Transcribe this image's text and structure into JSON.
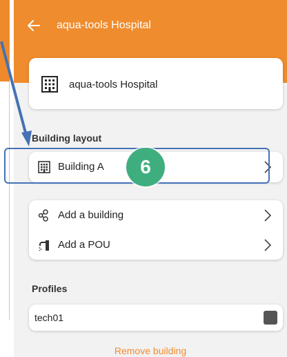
{
  "app": {
    "title": "aqua-tools Hospital",
    "accent": "#ef8c2e"
  },
  "hospital_card": {
    "name": "aqua-tools Hospital",
    "icon": "building-grid-icon"
  },
  "building_layout": {
    "heading": "Building layout",
    "items": [
      {
        "label": "Building A",
        "icon": "building-grid-icon"
      }
    ]
  },
  "actions": {
    "items": [
      {
        "label": "Add a building",
        "icon": "nodes-icon"
      },
      {
        "label": "Add a POU",
        "icon": "faucet-icon"
      }
    ]
  },
  "profiles": {
    "heading": "Profiles",
    "items": [
      {
        "name": "tech01"
      }
    ]
  },
  "footer": {
    "remove_label": "Remove building"
  },
  "annotation": {
    "step_number": "6",
    "highlight_color": "#4472b5",
    "badge_color": "#3fae7f"
  }
}
